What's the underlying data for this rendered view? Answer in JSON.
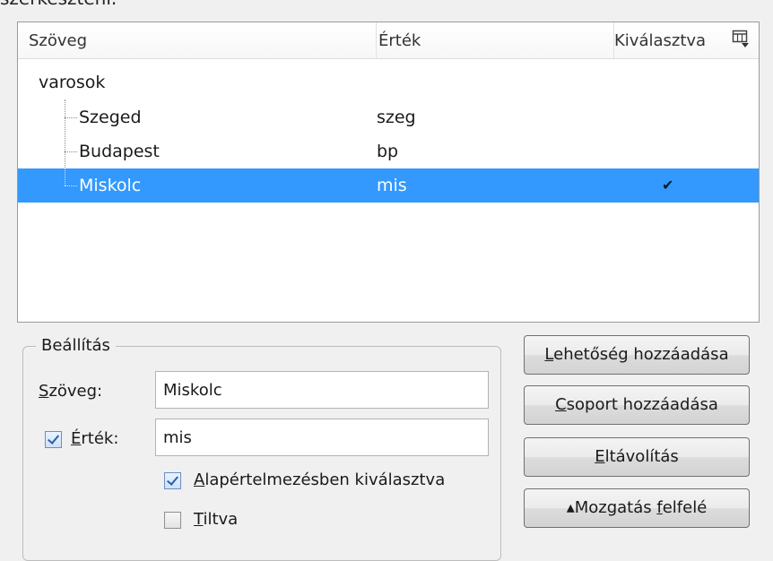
{
  "page": {
    "cut_title": "szerkeszteni."
  },
  "tree": {
    "columns": {
      "text": "Szöveg",
      "value": "Érték",
      "selected": "Kiválasztva"
    },
    "column_picker_icon": "column-chooser-icon",
    "group": "varosok",
    "rows": [
      {
        "text": "Szeged",
        "value": "szeg",
        "selected": false
      },
      {
        "text": "Budapest",
        "value": "bp",
        "selected": false
      },
      {
        "text": "Miskolc",
        "value": "mis",
        "selected": true,
        "check": "✔"
      }
    ],
    "selection_color": "#3399ff"
  },
  "settings": {
    "legend": "Beállítás",
    "text_label_key": "S",
    "text_label_rest": "zöveg:",
    "text_value": "Miskolc",
    "value_checked": true,
    "value_label_key": "É",
    "value_label_rest": "rték:",
    "value_value": "mis",
    "default_selected_checked": true,
    "default_selected_key": "A",
    "default_selected_rest": "lapértelmezésben kiválasztva",
    "disabled_checked": false,
    "disabled_key": "T",
    "disabled_rest": "iltva"
  },
  "buttons": {
    "add_option_key": "L",
    "add_option_rest": "ehetőség hozzáadása",
    "add_group_key": "C",
    "add_group_rest": "soport hozzáadása",
    "remove_key": "E",
    "remove_rest": "ltávolítás",
    "move_up_prefix": "▴Mozgatás ",
    "move_up_key": "f",
    "move_up_rest": "elfelé"
  }
}
